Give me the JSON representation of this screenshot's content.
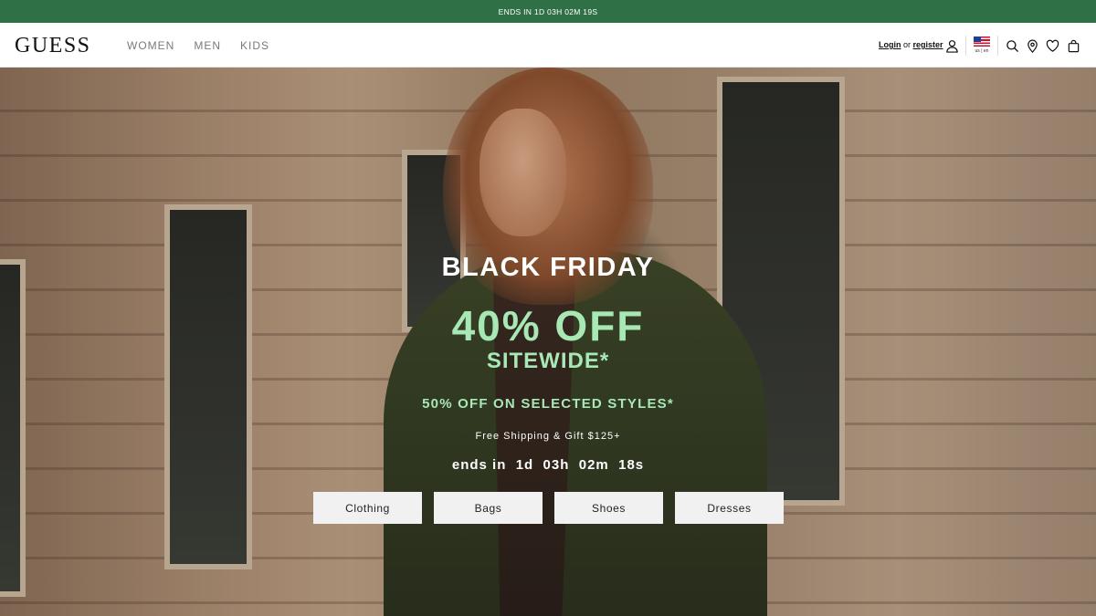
{
  "promo": {
    "text": "ENDS IN 1D 03H 02M 19S"
  },
  "header": {
    "logo": "GUESS",
    "nav": [
      "WOMEN",
      "MEN",
      "KIDS"
    ],
    "login_label": "Login",
    "or_label": "or",
    "register_label": "register",
    "locale": "us | en",
    "icons": [
      "account-icon",
      "us-flag-icon",
      "search-icon",
      "store-locator-icon",
      "wishlist-heart-icon",
      "shopping-bag-icon"
    ]
  },
  "hero": {
    "title": "BLACK FRIDAY",
    "discount": "40% OFF",
    "sitewide": "SITEWIDE*",
    "selected": "50% OFF ON SELECTED STYLES*",
    "shipping": "Free Shipping & Gift $125+",
    "countdown": "ends in  1d  03h  02m  18s",
    "buttons": [
      "Clothing",
      "Bags",
      "Shoes",
      "Dresses"
    ],
    "accent_color": "#a7e8b4"
  },
  "colors": {
    "promo_bar": "#2f7046",
    "text": "#111111"
  }
}
